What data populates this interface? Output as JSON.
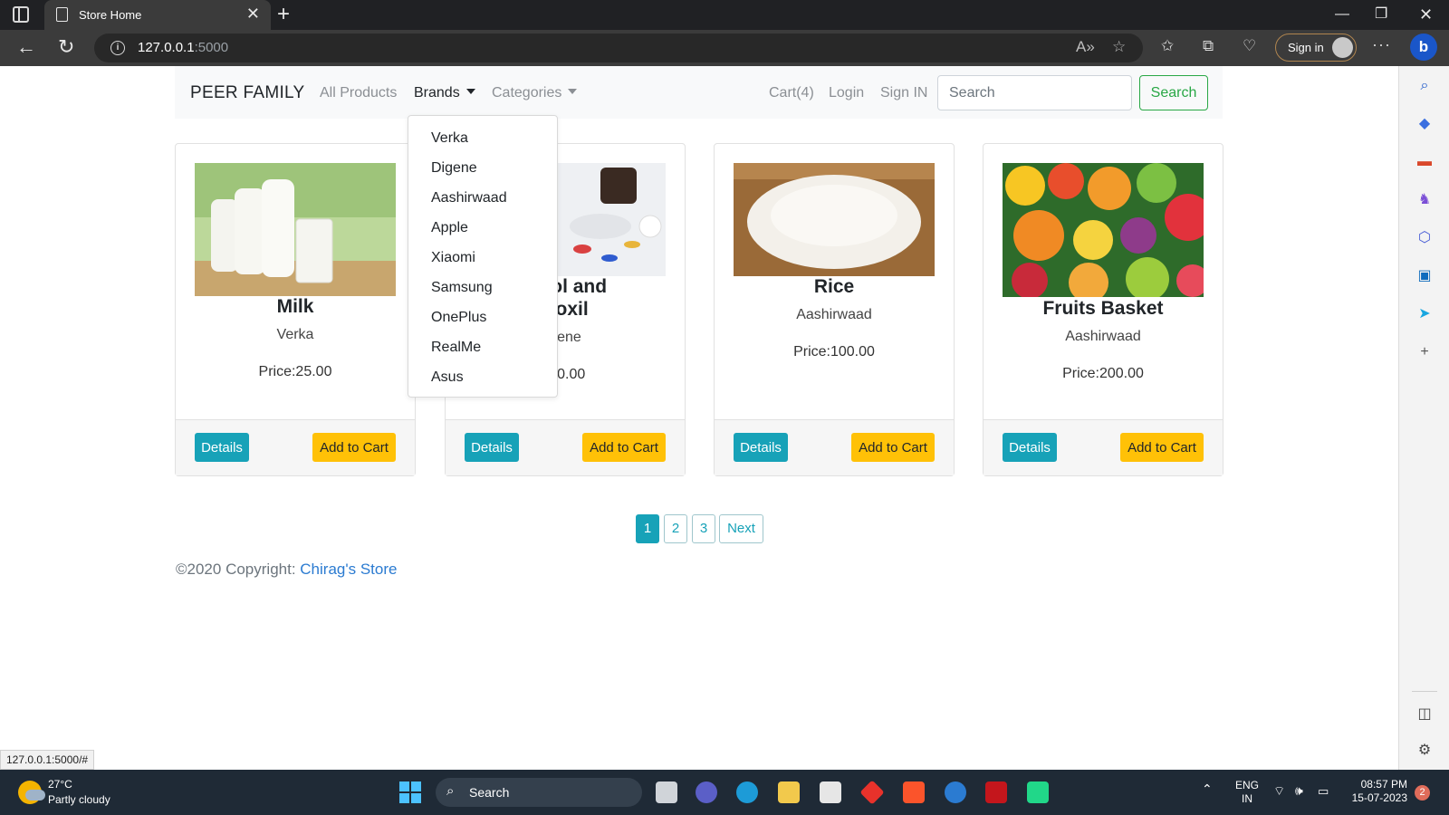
{
  "browser": {
    "tab_title": "Store Home",
    "url_host": "127.0.0.1",
    "url_port": ":5000",
    "signin_label": "Sign in",
    "status_url": "127.0.0.1:5000/#"
  },
  "navbar": {
    "brand": "PEER FAMILY",
    "links": {
      "all_products": "All Products",
      "brands": "Brands",
      "categories": "Categories",
      "cart": "Cart(4)",
      "login": "Login",
      "sign_in": "Sign IN"
    },
    "search_placeholder": "Search",
    "search_button": "Search"
  },
  "brands_dropdown": [
    "Verka",
    "Digene",
    "Aashirwaad",
    "Apple",
    "Xiaomi",
    "Samsung",
    "OnePlus",
    "RealMe",
    "Asus"
  ],
  "products": [
    {
      "title": "Milk",
      "brand": "Verka",
      "price": "Price:25.00",
      "details": "Details",
      "add_to_cart": "Add to Cart"
    },
    {
      "title_line1": "amol and",
      "title_line2": "troxil",
      "brand": "gene",
      "price": ":10.00",
      "details": "Details",
      "add_to_cart": "Add to Cart"
    },
    {
      "title": "Rice",
      "brand": "Aashirwaad",
      "price": "Price:100.00",
      "details": "Details",
      "add_to_cart": "Add to Cart"
    },
    {
      "title": "Fruits Basket",
      "brand": "Aashirwaad",
      "price": "Price:200.00",
      "details": "Details",
      "add_to_cart": "Add to Cart"
    }
  ],
  "pagination": {
    "pages": [
      "1",
      "2",
      "3"
    ],
    "next": "Next",
    "active": "1"
  },
  "footer": {
    "text": "©2020 Copyright: ",
    "link": "Chirag's Store"
  },
  "taskbar": {
    "weather_temp": "27°C",
    "weather_desc": "Partly cloudy",
    "search_label": "Search",
    "lang_line1": "ENG",
    "lang_line2": "IN",
    "time": "08:57 PM",
    "date": "15-07-2023",
    "notifications": "2"
  },
  "colors": {
    "accent": "#17a2b8",
    "cart_button": "#ffc107",
    "search_outline": "#28a745",
    "link": "#2b7bd1"
  }
}
